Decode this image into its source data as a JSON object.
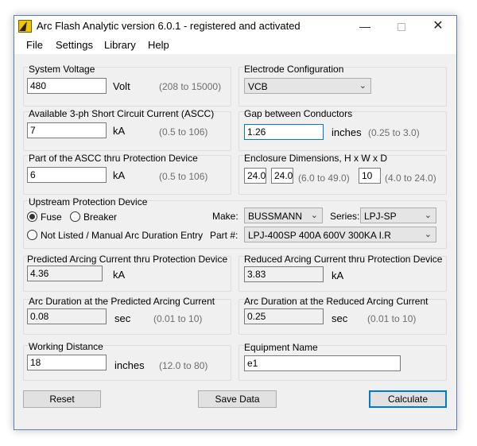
{
  "window": {
    "title": "Arc Flash Analytic version 6.0.1 - registered and activated"
  },
  "menu": {
    "file": "File",
    "settings": "Settings",
    "library": "Library",
    "help": "Help"
  },
  "system_voltage": {
    "label": "System Voltage",
    "value": "480",
    "unit": "Volt",
    "range": "(208 to 15000)"
  },
  "electrode": {
    "label": "Electrode Configuration",
    "selected": "VCB"
  },
  "ascc": {
    "label": "Available 3-ph Short Circuit Current (ASCC)",
    "value": "7",
    "unit": "kA",
    "range": "(0.5 to 106)"
  },
  "gap": {
    "label": "Gap between Conductors",
    "value": "1.26",
    "unit": "inches",
    "range": "(0.25 to 3.0)"
  },
  "part_ascc": {
    "label": "Part of the ASCC thru Protection Device",
    "value": "6",
    "unit": "kA",
    "range": "(0.5 to 106)"
  },
  "enclosure": {
    "label": "Enclosure Dimensions, H x W x D",
    "h": "24.0",
    "w": "24.0",
    "hw_range": "(6.0 to 49.0)",
    "d": "10",
    "d_range": "(4.0 to 24.0)"
  },
  "upstream": {
    "label": "Upstream Protection Device",
    "fuse": "Fuse",
    "breaker": "Breaker",
    "not_listed": "Not Listed / Manual Arc Duration Entry",
    "make_label": "Make:",
    "make": "BUSSMANN",
    "series_label": "Series:",
    "series": "LPJ-SP",
    "part_label": "Part #:",
    "part": "LPJ-400SP 400A 600V 300KA I.R"
  },
  "pred_arcing": {
    "label": "Predicted Arcing Current thru Protection Device",
    "value": "4.36",
    "unit": "kA"
  },
  "red_arcing": {
    "label": "Reduced Arcing Current thru Protection Device",
    "value": "3.83",
    "unit": "kA"
  },
  "arc_dur_pred": {
    "label": "Arc Duration at the Predicted Arcing Current",
    "value": "0.08",
    "unit": "sec",
    "range": "(0.01 to 10)"
  },
  "arc_dur_red": {
    "label": "Arc Duration at the Reduced Arcing Current",
    "value": "0.25",
    "unit": "sec",
    "range": "(0.01 to 10)"
  },
  "working": {
    "label": "Working Distance",
    "value": "18",
    "unit": "inches",
    "range": "(12.0 to 80)"
  },
  "equipment": {
    "label": "Equipment Name",
    "value": "e1"
  },
  "buttons": {
    "reset": "Reset",
    "save": "Save Data",
    "calculate": "Calculate"
  },
  "colors": {
    "accent": "#0078d7",
    "window_bg": "#f0f0f0",
    "range_text": "#6d6d6d"
  }
}
